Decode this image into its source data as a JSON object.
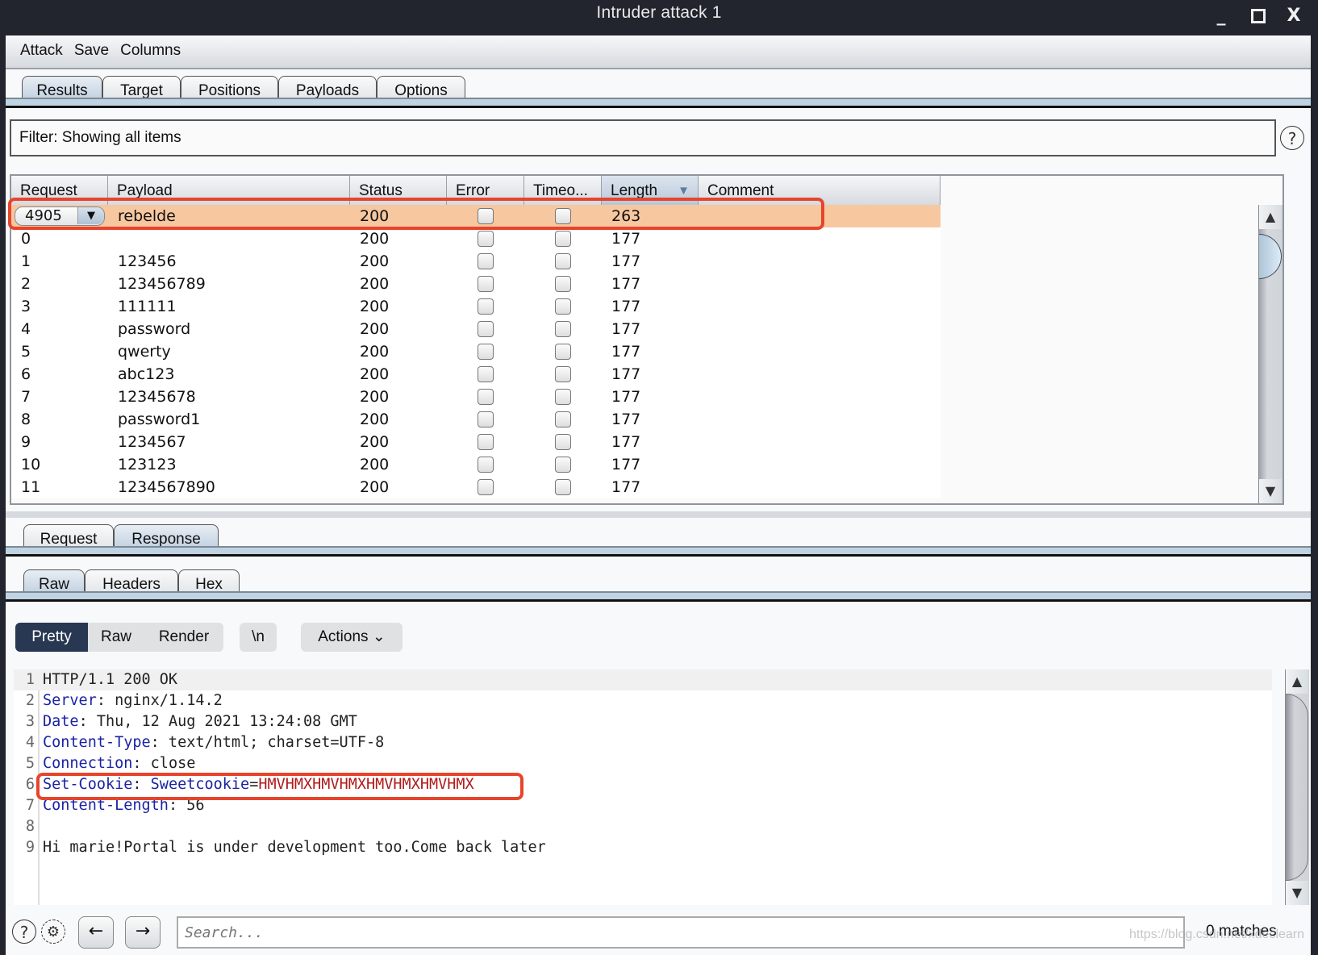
{
  "window": {
    "title": "Intruder attack 1",
    "controls": {
      "minimize": "_",
      "maximize": "☐",
      "close": "X"
    }
  },
  "menubar": {
    "items": [
      "Attack",
      "Save",
      "Columns"
    ]
  },
  "main_tabs": [
    {
      "label": "Results",
      "active": true
    },
    {
      "label": "Target",
      "active": false
    },
    {
      "label": "Positions",
      "active": false
    },
    {
      "label": "Payloads",
      "active": false
    },
    {
      "label": "Options",
      "active": false
    }
  ],
  "filter": {
    "text": "Filter:  Showing all items",
    "help": "?"
  },
  "results_table": {
    "columns": [
      "Request",
      "Payload",
      "Status",
      "Error",
      "Timeo...",
      "Length",
      "Comment"
    ],
    "sorted_column": "Length",
    "sort_icon": "▼",
    "highlight_color": "#f7c7a0",
    "selected_row": {
      "request": "4905",
      "payload": "rebelde",
      "status": "200",
      "error": false,
      "timeout": false,
      "length": "263",
      "comment": ""
    },
    "rows": [
      {
        "request": "0",
        "payload": "",
        "status": "200",
        "error": false,
        "timeout": false,
        "length": "177",
        "comment": ""
      },
      {
        "request": "1",
        "payload": "123456",
        "status": "200",
        "error": false,
        "timeout": false,
        "length": "177",
        "comment": ""
      },
      {
        "request": "2",
        "payload": "123456789",
        "status": "200",
        "error": false,
        "timeout": false,
        "length": "177",
        "comment": ""
      },
      {
        "request": "3",
        "payload": "111111",
        "status": "200",
        "error": false,
        "timeout": false,
        "length": "177",
        "comment": ""
      },
      {
        "request": "4",
        "payload": "password",
        "status": "200",
        "error": false,
        "timeout": false,
        "length": "177",
        "comment": ""
      },
      {
        "request": "5",
        "payload": "qwerty",
        "status": "200",
        "error": false,
        "timeout": false,
        "length": "177",
        "comment": ""
      },
      {
        "request": "6",
        "payload": "abc123",
        "status": "200",
        "error": false,
        "timeout": false,
        "length": "177",
        "comment": ""
      },
      {
        "request": "7",
        "payload": "12345678",
        "status": "200",
        "error": false,
        "timeout": false,
        "length": "177",
        "comment": ""
      },
      {
        "request": "8",
        "payload": "password1",
        "status": "200",
        "error": false,
        "timeout": false,
        "length": "177",
        "comment": ""
      },
      {
        "request": "9",
        "payload": "1234567",
        "status": "200",
        "error": false,
        "timeout": false,
        "length": "177",
        "comment": ""
      },
      {
        "request": "10",
        "payload": "123123",
        "status": "200",
        "error": false,
        "timeout": false,
        "length": "177",
        "comment": ""
      },
      {
        "request": "11",
        "payload": "1234567890",
        "status": "200",
        "error": false,
        "timeout": false,
        "length": "177",
        "comment": ""
      }
    ]
  },
  "message_tabs": [
    {
      "label": "Request",
      "active": false
    },
    {
      "label": "Response",
      "active": true
    }
  ],
  "view_tabs": [
    {
      "label": "Raw",
      "active": true
    },
    {
      "label": "Headers",
      "active": false
    },
    {
      "label": "Hex",
      "active": false
    }
  ],
  "editor_toolbar": {
    "pretty": "Pretty",
    "raw": "Raw",
    "render": "Render",
    "newline": "\\n",
    "actions": "Actions ⌄"
  },
  "response_lines": [
    {
      "n": "1",
      "text": "HTTP/1.1 200 OK"
    },
    {
      "n": "2",
      "key": "Server",
      "value": " nginx/1.14.2"
    },
    {
      "n": "3",
      "key": "Date",
      "value": " Thu, 12 Aug 2021 13:24:08 GMT"
    },
    {
      "n": "4",
      "key": "Content-Type",
      "value": " text/html; charset=UTF-8"
    },
    {
      "n": "5",
      "key": "Connection",
      "value": " close"
    },
    {
      "n": "6",
      "key": "Set-Cookie",
      "cookie_name": "Sweetcookie",
      "cookie_value": "HMVHMXHMVHMXHMVHMXHMVHMX"
    },
    {
      "n": "7",
      "key": "Content-Length",
      "value": " 56"
    },
    {
      "n": "8",
      "text": ""
    },
    {
      "n": "9",
      "text": "Hi marie!Portal is under development too.Come back later"
    }
  ],
  "bottom_bar": {
    "help": "?",
    "settings": "⚙",
    "back": "←",
    "forward": "→",
    "search_placeholder": "Search...",
    "matches": "0 matches"
  },
  "watermark": "https://blog.csdn.net/xdeclearn"
}
